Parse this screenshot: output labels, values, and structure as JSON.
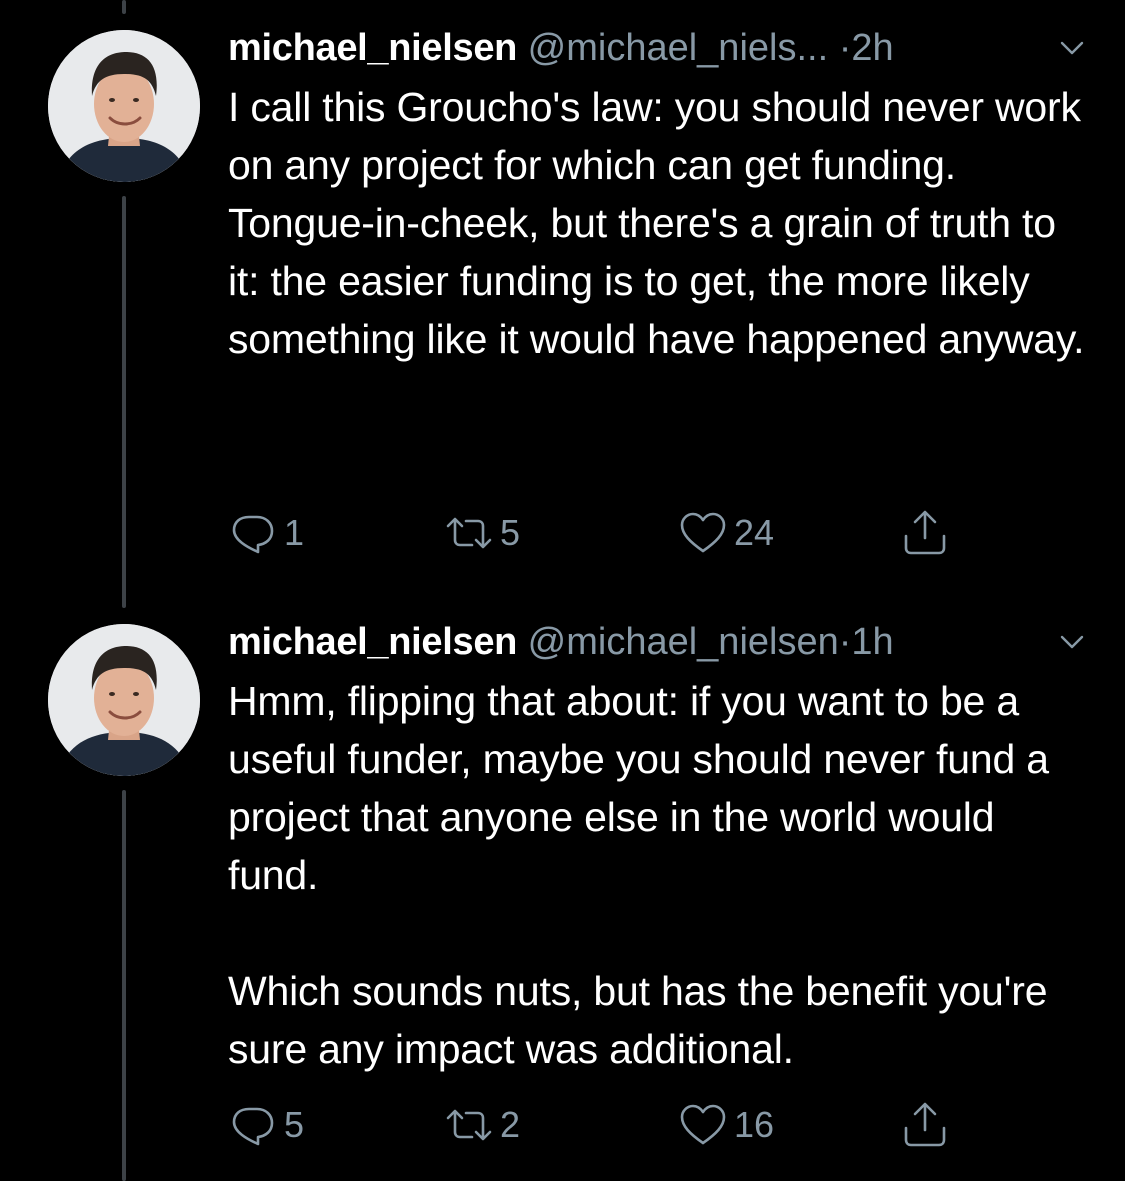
{
  "tweets": [
    {
      "name": "michael_nielsen",
      "handle": "@michael_niels...",
      "dot": "·",
      "time": "2h",
      "paragraphs": [
        "I call this Groucho's law: you should never work on any project for which can get funding. Tongue-in-cheek, but there's a grain of truth to it: the easier funding is to get, the more likely something like it would have happened anyway."
      ],
      "replies": "1",
      "retweets": "5",
      "likes": "24"
    },
    {
      "name": "michael_nielsen",
      "handle": "@michael_nielsen",
      "dot": "·",
      "time": "1h",
      "paragraphs": [
        "Hmm, flipping that about: if you want to be a useful funder, maybe you should never fund a project that anyone else in the world would fund.",
        "Which sounds nuts, but has the benefit you're sure any impact was additional."
      ],
      "replies": "5",
      "retweets": "2",
      "likes": "16"
    }
  ],
  "colors": {
    "background": "#000000",
    "text": "#ffffff",
    "muted": "#8899a6",
    "thread_line": "#3d4247"
  },
  "icons": [
    "reply-icon",
    "retweet-icon",
    "like-icon",
    "share-icon",
    "chevron-down-icon"
  ]
}
